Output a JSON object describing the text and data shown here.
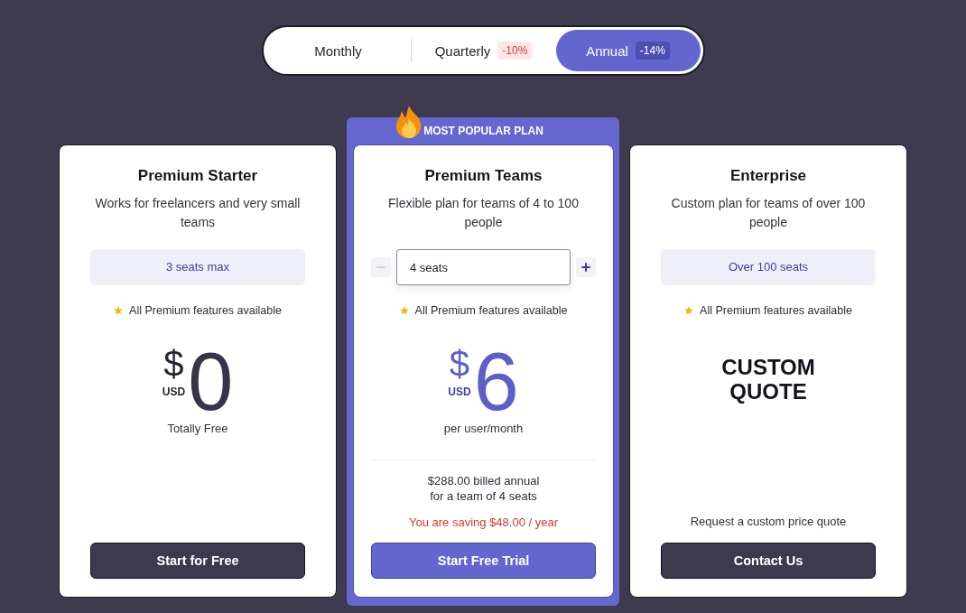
{
  "billing_toggle": {
    "options": [
      {
        "label": "Monthly",
        "selected": false
      },
      {
        "label": "Quarterly",
        "badge": "-10%",
        "selected": false
      },
      {
        "label": "Annual",
        "badge": "-14%",
        "selected": true
      }
    ]
  },
  "plans": [
    {
      "kind": "fixed",
      "highlighted": false,
      "title": "Premium Starter",
      "description": "Works for freelancers and very small teams",
      "seats": "3 seats max",
      "feature": "All Premium features available",
      "price": {
        "symbol": "$",
        "currency": "USD",
        "amount": "0"
      },
      "price_note": "Totally Free",
      "button": "Start for Free"
    },
    {
      "kind": "stepper",
      "highlighted": true,
      "ribbon": "MOST POPULAR PLAN",
      "title": "Premium Teams",
      "description": "Flexible plan for teams of 4 to 100 people",
      "seat_input": {
        "value": "4 seats",
        "decrease_disabled": true,
        "increase_disabled": false
      },
      "feature": "All Premium features available",
      "price": {
        "symbol": "$",
        "currency": "USD",
        "amount": "6"
      },
      "price_note": "per user/month",
      "billing_lines": [
        "$288.00 billed annual",
        "for a team of 4 seats"
      ],
      "savings": "You are saving $48.00 / year",
      "button": "Start Free Trial"
    },
    {
      "kind": "custom",
      "highlighted": false,
      "title": "Enterprise",
      "description": "Custom plan for teams of over 100 people",
      "seats": "Over 100 seats",
      "feature": "All Premium features available",
      "quote": "CUSTOM QUOTE",
      "price_note": "Request a custom price quote",
      "button": "Contact Us"
    }
  ]
}
